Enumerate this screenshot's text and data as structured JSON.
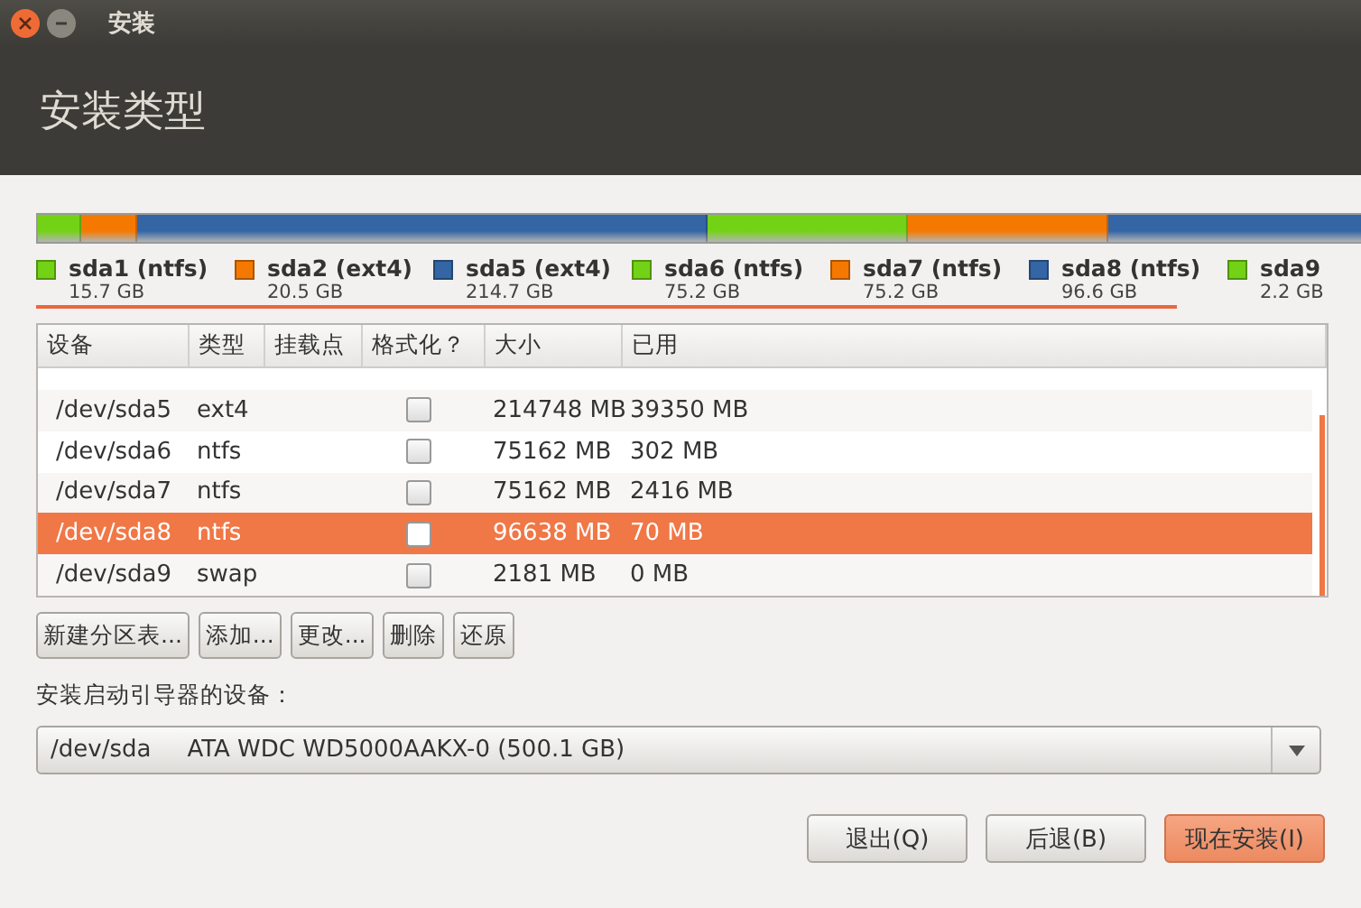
{
  "window": {
    "title": "安装"
  },
  "header": {
    "title": "安装类型"
  },
  "partitions": [
    {
      "name": "sda1 (ntfs)",
      "size": "15.7 GB",
      "color": "#73d216"
    },
    {
      "name": "sda2 (ext4)",
      "size": "20.5 GB",
      "color": "#f57900"
    },
    {
      "name": "sda5 (ext4)",
      "size": "214.7 GB",
      "color": "#3465a4"
    },
    {
      "name": "sda6 (ntfs)",
      "size": "75.2 GB",
      "color": "#73d216"
    },
    {
      "name": "sda7 (ntfs)",
      "size": "75.2 GB",
      "color": "#f57900"
    },
    {
      "name": "sda8 (ntfs)",
      "size": "96.6 GB",
      "color": "#3465a4"
    },
    {
      "name": "sda9",
      "size": "2.2 GB",
      "color": "#73d216"
    }
  ],
  "table": {
    "columns": [
      "设备",
      "类型",
      "挂载点",
      "格式化？",
      "大小",
      "已用"
    ],
    "rows": [
      {
        "device": "/dev/sda5",
        "type": "ext4",
        "format": false,
        "size": "214748 MB",
        "used": "39350 MB",
        "selected": false
      },
      {
        "device": "/dev/sda6",
        "type": "ntfs",
        "format": false,
        "size": "75162 MB",
        "used": "302 MB",
        "selected": false
      },
      {
        "device": "/dev/sda7",
        "type": "ntfs",
        "format": false,
        "size": "75162 MB",
        "used": "2416 MB",
        "selected": false
      },
      {
        "device": "/dev/sda8",
        "type": "ntfs",
        "format": false,
        "size": "96638 MB",
        "used": "70 MB",
        "selected": true
      },
      {
        "device": "/dev/sda9",
        "type": "swap",
        "format": false,
        "size": "2181 MB",
        "used": "0 MB",
        "selected": false
      }
    ]
  },
  "partition_buttons": [
    "新建分区表...",
    "添加...",
    "更改...",
    "删除",
    "还原"
  ],
  "bootloader": {
    "label": "安装启动引导器的设备：",
    "device": "/dev/sda",
    "description": "ATA WDC WD5000AAKX-0 (500.1 GB)"
  },
  "buttons": [
    {
      "label": "退出(Q)",
      "kind": "normal"
    },
    {
      "label": "后退(B)",
      "kind": "normal"
    },
    {
      "label": "现在安装(I)",
      "kind": "primary"
    }
  ]
}
